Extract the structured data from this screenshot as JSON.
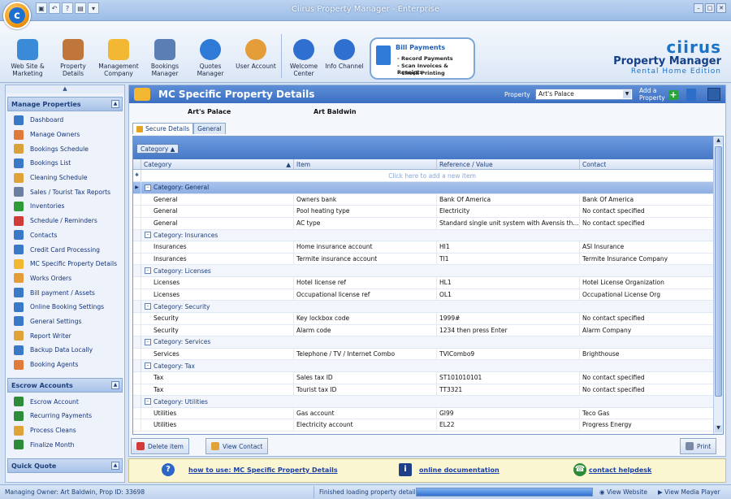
{
  "window": {
    "title": "Ciirus Property Manager - Enterprise"
  },
  "ribbon": {
    "items": [
      {
        "label": "Web Site & Marketing",
        "icon": "globe-icon",
        "color": "#3a8ad8"
      },
      {
        "label": "Property Details",
        "icon": "house-icon",
        "color": "#c0753a"
      },
      {
        "label": "Management Company",
        "icon": "company-icon",
        "color": "#f2b733"
      },
      {
        "label": "Bookings Manager",
        "icon": "calendar-icon",
        "color": "#5a7fb5"
      },
      {
        "label": "Quotes Manager",
        "icon": "quote-icon",
        "color": "#2f7ad6"
      },
      {
        "label": "User Account",
        "icon": "users-icon",
        "color": "#e59d3a"
      },
      {
        "label": "Welcome Center",
        "icon": "help-icon",
        "color": "#2f6fd0"
      },
      {
        "label": "Info Channel",
        "icon": "info-icon",
        "color": "#2f6fd0"
      }
    ],
    "bill_payments": {
      "title": "Bill Payments",
      "lines": [
        "- Record Payments",
        "- Scan Invoices & Receipts",
        "- Check Printing"
      ]
    },
    "logo": {
      "brand": "ciirus",
      "product": "Property Manager",
      "edition": "Rental Home Edition"
    }
  },
  "sidebar": {
    "sections": [
      {
        "title": "Manage Properties",
        "items": [
          {
            "label": "Dashboard",
            "color": "#3a78c8"
          },
          {
            "label": "Manage Owners",
            "color": "#e07a3a"
          },
          {
            "label": "Bookings Schedule",
            "color": "#d9a13a"
          },
          {
            "label": "Bookings List",
            "color": "#3a78c8"
          },
          {
            "label": "Cleaning Schedule",
            "color": "#e0a33a"
          },
          {
            "label": "Sales / Tourist Tax Reports",
            "color": "#6d7fa0"
          },
          {
            "label": "Inventories",
            "color": "#2e9b3a"
          },
          {
            "label": "Schedule / Reminders",
            "color": "#d33a3a"
          },
          {
            "label": "Contacts",
            "color": "#3a78c8"
          },
          {
            "label": "Credit Card Processing",
            "color": "#3a78c8"
          },
          {
            "label": "MC Specific Property Details",
            "color": "#f2b733"
          },
          {
            "label": "Works Orders",
            "color": "#e59d3a"
          },
          {
            "label": "Bill payment / Assets",
            "color": "#3a78c8"
          },
          {
            "label": "Online Booking Settings",
            "color": "#3a78c8"
          },
          {
            "label": "General Settings",
            "color": "#3a78c8"
          },
          {
            "label": "Report Writer",
            "color": "#e0a33a"
          },
          {
            "label": "Backup Data Locally",
            "color": "#3a78c8"
          },
          {
            "label": "Booking Agents",
            "color": "#e07a3a"
          }
        ]
      },
      {
        "title": "Escrow Accounts",
        "items": [
          {
            "label": "Escrow Account",
            "color": "#2e8b3a"
          },
          {
            "label": "Recurring Payments",
            "color": "#2e8b3a"
          },
          {
            "label": "Process Cleans",
            "color": "#e0a33a"
          },
          {
            "label": "Finalize Month",
            "color": "#2e8b3a"
          }
        ]
      },
      {
        "title": "Quick Quote",
        "items": []
      }
    ]
  },
  "main": {
    "title": "MC Specific Property Details",
    "property_label": "Property",
    "property_value": "Art's Palace",
    "add_property": [
      "Add a",
      "Property"
    ],
    "property_name": "Art's Palace",
    "owner_name": "Art Baldwin",
    "tabs": [
      "Secure Details",
      "General"
    ],
    "group_chip": "Category",
    "columns": [
      "Category",
      "Item",
      "Reference / Value",
      "Contact"
    ],
    "add_row_text": "Click here to add a new item",
    "groups": [
      {
        "label": "Category: General",
        "rows": [
          [
            "General",
            "Owners bank",
            "Bank Of America",
            "Bank Of America"
          ],
          [
            "General",
            "Pool heating type",
            "Electricity",
            "No contact specified"
          ],
          [
            "General",
            "AC type",
            "Standard single unit system with Avensis thermostat",
            "No contact specified"
          ]
        ]
      },
      {
        "label": "Category: Insurances",
        "rows": [
          [
            "Insurances",
            "Home insurance account",
            "HI1",
            "ASI Insurance"
          ],
          [
            "Insurances",
            "Termite insurance account",
            "TI1",
            "Termite Insurance Company"
          ]
        ]
      },
      {
        "label": "Category: Licenses",
        "rows": [
          [
            "Licenses",
            "Hotel license ref",
            "HL1",
            "Hotel License Organization"
          ],
          [
            "Licenses",
            "Occupational license ref",
            "OL1",
            "Occupational License Org"
          ]
        ]
      },
      {
        "label": "Category: Security",
        "rows": [
          [
            "Security",
            "Key lockbox code",
            "1999#",
            "No contact specified"
          ],
          [
            "Security",
            "Alarm code",
            "1234 then press Enter",
            "Alarm Company"
          ]
        ]
      },
      {
        "label": "Category: Services",
        "rows": [
          [
            "Services",
            "Telephone / TV / Internet Combo",
            "TVICombo9",
            "Brighthouse"
          ]
        ]
      },
      {
        "label": "Category: Tax",
        "rows": [
          [
            "Tax",
            "Sales tax ID",
            "ST101010101",
            "No contact specified"
          ],
          [
            "Tax",
            "Tourist tax ID",
            "TT3321",
            "No contact specified"
          ]
        ]
      },
      {
        "label": "Category: Utilities",
        "rows": [
          [
            "Utilities",
            "Gas account",
            "GI99",
            "Teco Gas"
          ],
          [
            "Utilities",
            "Electricity account",
            "EL22",
            "Progress Energy"
          ]
        ]
      }
    ],
    "buttons": {
      "delete": "Delete item",
      "view_contact": "View Contact",
      "print": "Print"
    }
  },
  "help": {
    "how_to": "how to use: MC Specific Property Details",
    "docs": "online documentation",
    "helpdesk": "contact helpdesk"
  },
  "status": {
    "owner": "Managing Owner: Art Baldwin, Prop ID: 33698",
    "message": "Finished loading property details",
    "progress": 1.0,
    "view_website": "View Website",
    "view_media": "View Media Player"
  }
}
